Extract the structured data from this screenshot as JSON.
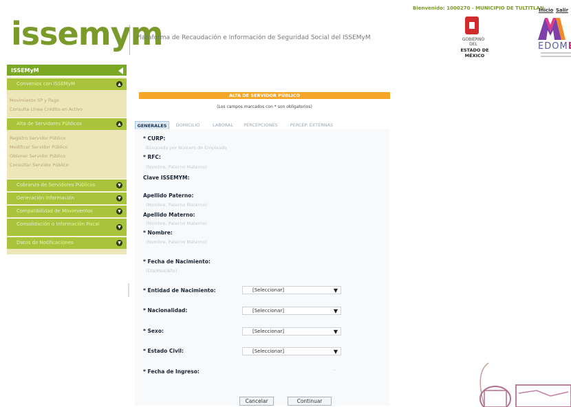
{
  "header": {
    "logo": "issemym",
    "platform_title": "Plataforma de Recaudación e Información de Seguridad Social del ISSEMyM",
    "welcome": "Bienvenido: 1000270 - MUNICIPIO DE TULTITLAN",
    "link_inicio": "Inicio",
    "link_salir": "Salir",
    "gobierno_line1": "GOBIERNO DEL",
    "gobierno_line2": "ESTADO DE MÉXICO",
    "edomex_prefix": "EDOM",
    "edomex_suffix": "E"
  },
  "sidebar": {
    "title": "ISSEMyM",
    "groups": [
      {
        "label": "Convenios con ISSEMyM",
        "toggle": "▲"
      },
      {
        "label": "Alta de Servidores Públicos",
        "toggle": "▲"
      },
      {
        "label": "Cobranza de Servidores Públicos",
        "toggle": "▼"
      },
      {
        "label": "Generación Información",
        "toggle": "▼"
      },
      {
        "label": "Compatibilidad de Movimientos",
        "toggle": "▼"
      },
      {
        "label": "Consolidación o Información Fiscal",
        "toggle": "▼"
      },
      {
        "label": "Datos de Notificaciones",
        "toggle": "▼"
      }
    ],
    "links_group1": [
      "Movimiento SP y Pago",
      "Consulta Línea Crédito en Activo"
    ],
    "links_group2": [
      "Registro Servidor Público",
      "Modificar Servidor Público",
      "Obtener Servidor Público",
      "Consultar Servidor Público"
    ]
  },
  "form": {
    "banner": "ALTA DE SERVIDOR PÚBLICO",
    "required_note": "(Los campos marcados con * son obligatorios)",
    "tabs": [
      "GENERALES",
      "DOMICILIO",
      "LABORAL",
      "PERCEPCIONES",
      "PERCEP. EXTERNAS"
    ],
    "fields": {
      "curp_label": "* CURP:",
      "curp_placeholder": "Búsqueda por Número de Empleado",
      "rfc_label": "* RFC:",
      "rfc_placeholder": "(Nombre, Paterno Materno)",
      "clave_label": "Clave ISSEMYM:",
      "ap_paterno_label": "Apellido Paterno:",
      "ap_paterno_placeholder": "(Nombre, Paterno Materno)",
      "ap_materno_label": "Apellido Materno:",
      "ap_materno_placeholder": "(Nombre, Paterno Materno)",
      "nombre_label": "* Nombre:",
      "nombre_placeholder": "(Nombre, Paterno Materno)",
      "fecha_nac_label": "* Fecha de Nacimiento:",
      "fecha_nac_placeholder": "(Día/Mes/Año)",
      "entidad_label": "* Entidad de Nacimiento:",
      "nacionalidad_label": "* Nacionalidad:",
      "sexo_label": "* Sexo:",
      "estado_civil_label": "* Estado Civil:",
      "fecha_ingreso_label": "* Fecha de Ingreso:"
    },
    "select_value": "[Seleccionar]",
    "cancel_label": "Cancelar",
    "continue_label": "Continuar"
  },
  "colors": {
    "brand_green": "#7aa824",
    "accent_orange": "#f5a628",
    "sidebar_bg": "#ece6b8"
  }
}
